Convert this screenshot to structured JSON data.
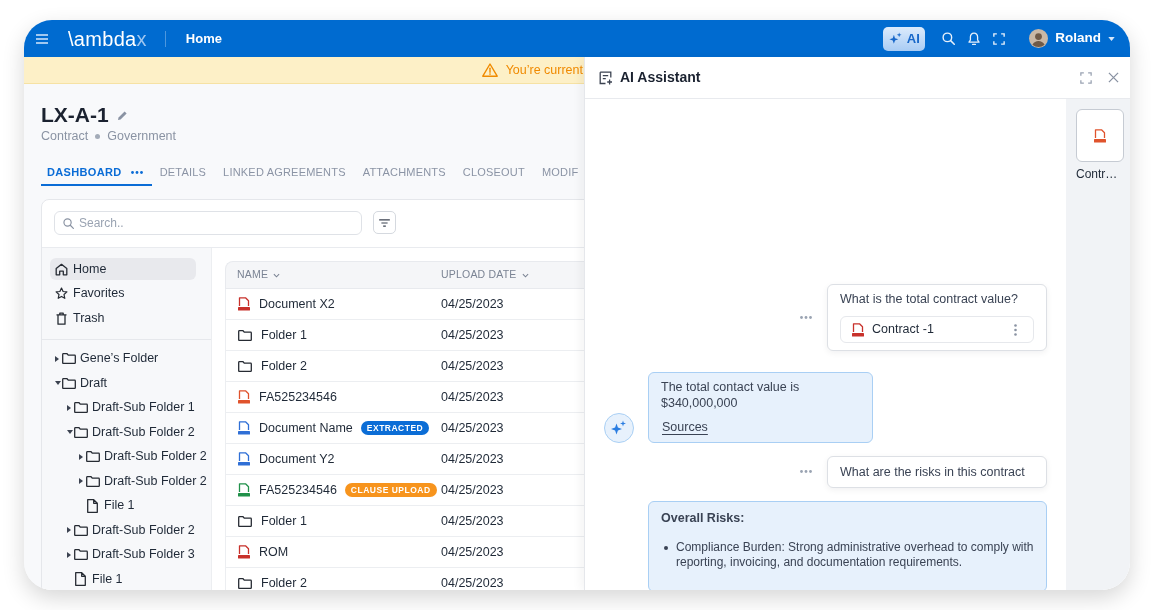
{
  "navbar": {
    "logo": {
      "text": "\\ambda",
      "accent": "x"
    },
    "page_title": "Home",
    "ai_button": "AI",
    "user": "Roland"
  },
  "banner": {
    "text": "You’re current"
  },
  "record": {
    "title": "LX-A-1",
    "meta": [
      "Contract",
      "Government"
    ]
  },
  "tabs": [
    {
      "label": "DASHBOARD",
      "selected": true
    },
    {
      "label": "DETAILS",
      "selected": false
    },
    {
      "label": "LINKED AGREEMENTS",
      "selected": false
    },
    {
      "label": "ATTACHMENTS",
      "selected": false
    },
    {
      "label": "CLOSEOUT",
      "selected": false
    },
    {
      "label": "MODIF",
      "selected": false
    }
  ],
  "search": {
    "placeholder": "Search.."
  },
  "sidebar": {
    "items": [
      {
        "kind": "home",
        "label": "Home",
        "selected": true
      },
      {
        "kind": "favorites",
        "label": "Favorites",
        "selected": false
      },
      {
        "kind": "trash",
        "label": "Trash",
        "selected": false
      }
    ],
    "tree": [
      {
        "kind": "folder",
        "label": "Gene’s Folder",
        "expanded": false
      },
      {
        "kind": "folder",
        "label": "Draft",
        "expanded": true,
        "children": [
          {
            "kind": "folder",
            "label": "Draft-Sub Folder 1",
            "expanded": false
          },
          {
            "kind": "folder",
            "label": "Draft-Sub Folder 2",
            "expanded": true,
            "children": [
              {
                "kind": "folder",
                "label": "Draft-Sub Folder 2",
                "expanded": false
              },
              {
                "kind": "folder",
                "label": "Draft-Sub Folder 2",
                "expanded": false
              },
              {
                "kind": "file",
                "label": "File 1"
              }
            ]
          },
          {
            "kind": "folder",
            "label": "Draft-Sub Folder 2",
            "expanded": false
          },
          {
            "kind": "folder",
            "label": "Draft-Sub Folder 3",
            "expanded": false
          },
          {
            "kind": "file",
            "label": "File 1"
          }
        ]
      }
    ]
  },
  "table": {
    "columns": [
      {
        "label": "NAME"
      },
      {
        "label": "UPLOAD DATE"
      }
    ],
    "rows": [
      {
        "kind": "pdf",
        "name": "Document X2",
        "date": "04/25/2023"
      },
      {
        "kind": "folder",
        "name": "Folder 1",
        "date": "04/25/2023"
      },
      {
        "kind": "folder",
        "name": "Folder 2",
        "date": "04/25/2023"
      },
      {
        "kind": "ppt",
        "name": "FA525234546",
        "date": "04/25/2023"
      },
      {
        "kind": "docx",
        "name": "Document Name",
        "badge": {
          "text": "EXTRACTED",
          "color": "#0b6dd6"
        },
        "date": "04/25/2023"
      },
      {
        "kind": "docx",
        "name": "Document Y2",
        "date": "04/25/2023"
      },
      {
        "kind": "xlsx",
        "name": "FA525234546",
        "badge": {
          "text": "CLAUSE UPLOAD",
          "color": "#f7941d"
        },
        "date": "04/25/2023"
      },
      {
        "kind": "folder",
        "name": "Folder 1",
        "date": "04/25/2023"
      },
      {
        "kind": "pdf",
        "name": "ROM",
        "date": "04/25/2023"
      },
      {
        "kind": "folder",
        "name": "Folder 2",
        "date": "04/25/2023"
      }
    ]
  },
  "assistant": {
    "title": "AI Assistant",
    "files": [
      {
        "kind": "ppt",
        "name": "Contr…"
      }
    ],
    "messages": [
      {
        "kind": "question",
        "text": "What is the total contract value?",
        "attachment": {
          "kind": "pdf",
          "name": "Contract -1"
        }
      },
      {
        "kind": "answer",
        "avatar": true,
        "text": "The total contact value is $340,000,000",
        "link": "Sources"
      },
      {
        "kind": "question",
        "text": "What are the risks in this contract"
      },
      {
        "kind": "answer",
        "avatar": false,
        "heading": "Overall Risks:",
        "bullets": [
          "Compliance Burden: Strong administrative overhead to comply with reporting, invoicing, and documentation requirements."
        ]
      }
    ]
  }
}
